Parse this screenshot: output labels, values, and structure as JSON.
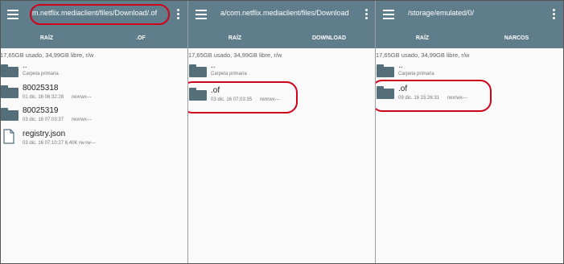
{
  "panes": [
    {
      "path": "m.netflix.mediaclient/files/Download/.of",
      "tabs": [
        "RAÍZ",
        ".OF"
      ],
      "storage": "17,65GB usado, 34,99GB libre, r/w",
      "entries": [
        {
          "name": "..",
          "date": "Carpeta primaria",
          "size": "",
          "perm": "",
          "icon": "folder-icon"
        },
        {
          "name": "80025318",
          "date": "01 dic. 16 06:32:28",
          "size": "",
          "perm": "rwxrwx---",
          "icon": "folder-icon"
        },
        {
          "name": "80025319",
          "date": "03 dic. 16 07:03:37",
          "size": "",
          "perm": "rwxrwx---",
          "icon": "folder-icon"
        },
        {
          "name": "registry.json",
          "date": "03 dic. 16 07:10:27",
          "size": "6,40K",
          "perm": "rw-rw---",
          "icon": "file-icon"
        }
      ]
    },
    {
      "path": "a/com.netflix.mediaclient/files/Download",
      "tabs": [
        "RAÍZ",
        "DOWNLOAD"
      ],
      "storage": "17,65GB usado, 34,99GB libre, r/w",
      "entries": [
        {
          "name": "..",
          "date": "Carpeta primaria",
          "size": "",
          "perm": "",
          "icon": "folder-icon"
        },
        {
          "name": ".of",
          "date": "03 dic. 16 07:03:35",
          "size": "",
          "perm": "rwxrwx---",
          "icon": "folder-icon"
        }
      ]
    },
    {
      "path": "/storage/emulated/0/",
      "tabs": [
        "RAÍZ",
        "NARCOS"
      ],
      "storage": "17,65GB usado, 34,99GB libre, r/w",
      "entries": [
        {
          "name": "..",
          "date": "Carpeta primaria",
          "size": "",
          "perm": "",
          "icon": "folder-icon"
        },
        {
          "name": ".of",
          "date": "09 dic. 16 15:26:31",
          "size": "",
          "perm": "rwxrwx---",
          "icon": "folder-icon"
        }
      ]
    }
  ],
  "colors": {
    "appbar": "#607d8b",
    "folder": "#546e7a",
    "highlight": "#d0021b",
    "background": "#fafafa"
  }
}
